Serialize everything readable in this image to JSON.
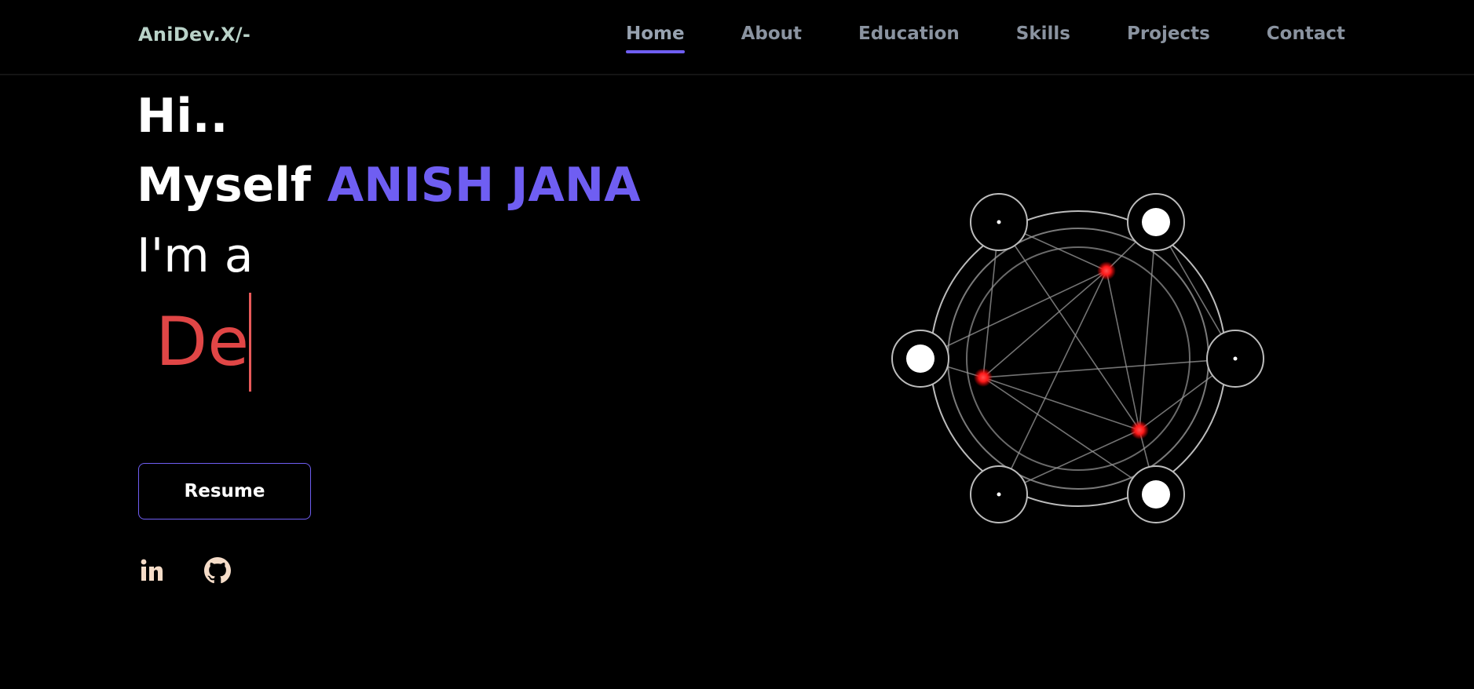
{
  "brand": "AniDev.X/-",
  "nav": {
    "items": [
      {
        "label": "Home",
        "active": true
      },
      {
        "label": "About",
        "active": false
      },
      {
        "label": "Education",
        "active": false
      },
      {
        "label": "Skills",
        "active": false
      },
      {
        "label": "Projects",
        "active": false
      },
      {
        "label": "Contact",
        "active": false
      }
    ]
  },
  "hero": {
    "greeting": "Hi..",
    "intro": "Myself",
    "name": "ANISH JANA",
    "role_prefix": "I'm a",
    "typed_text": "De",
    "resume_label": "Resume"
  },
  "socials": [
    {
      "icon": "linkedin-icon"
    },
    {
      "icon": "github-icon"
    }
  ],
  "colors": {
    "background": "#000000",
    "accent": "#6f5ef2",
    "brand": "#b9d2c8",
    "nav_text": "#8a93a0",
    "typed": "#e04646",
    "social_icon": "#f5dcc8",
    "node_glow": "#ff2020"
  }
}
